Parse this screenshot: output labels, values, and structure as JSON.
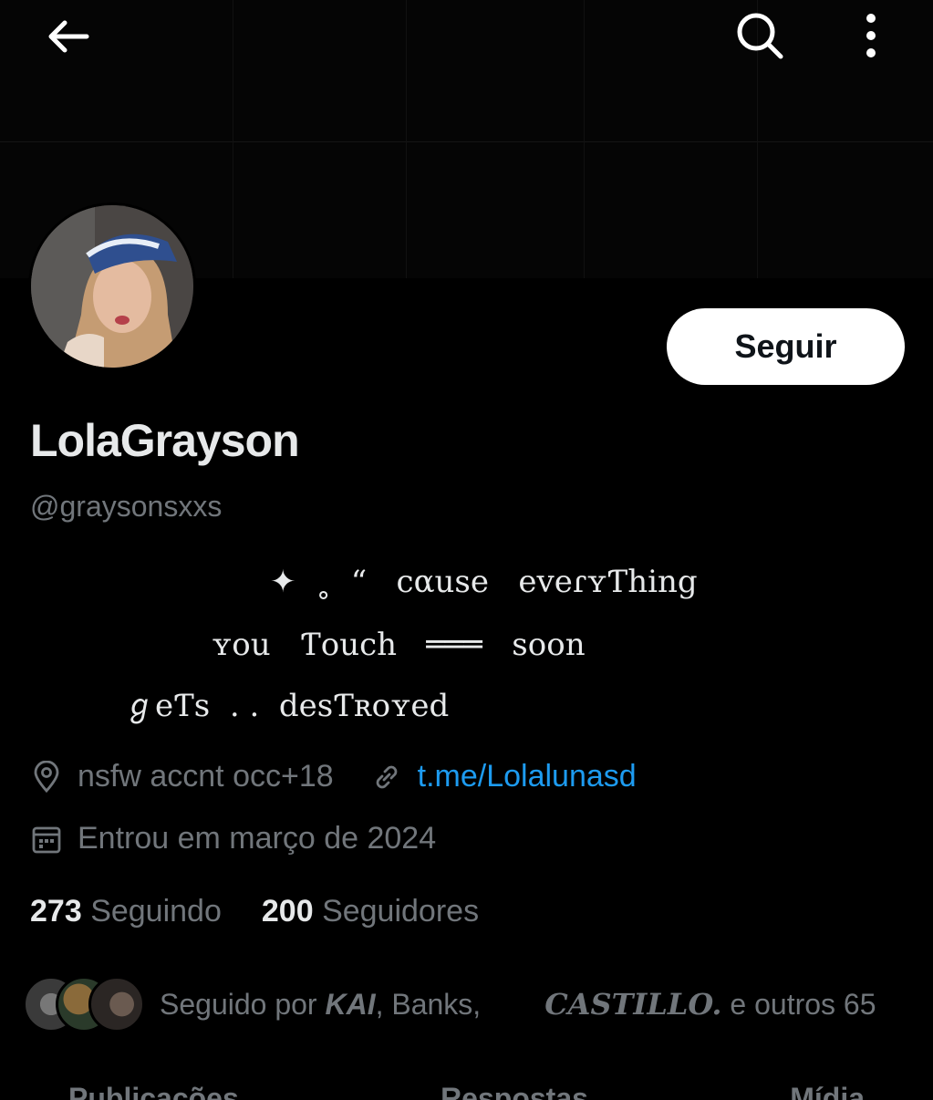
{
  "header": {
    "back_icon": "arrow-left-icon",
    "search_icon": "search-icon",
    "more_icon": "more-vertical-icon"
  },
  "profile": {
    "display_name": "LolaGrayson",
    "handle": "@graysonsxxs",
    "follow_label": "Seguir",
    "bio": {
      "line1": "✦  ˳  “   cαuse   eveɾʏƬhing",
      "line2": "ʏou   Ƭouch   ═══   soon",
      "line3": "ℊeƬs  . .  desƬʀoʏed"
    },
    "location": "nsfw accnt occ+18",
    "link": "t.me/Lolalunasd",
    "joined": "Entrou em março de 2024"
  },
  "stats": {
    "following_count": "273",
    "following_label": "Seguindo",
    "followers_count": "200",
    "followers_label": "Seguidores"
  },
  "followed_by": {
    "prefix": "Seguido por",
    "name1": "KAI",
    "sep1": ",",
    "name2": "Banks,",
    "name3": "CASTILLO.",
    "suffix": "e outros 65"
  },
  "tabs": [
    {
      "label": "Publicações"
    },
    {
      "label": "Respostas"
    },
    {
      "label": "Mídia"
    }
  ],
  "colors": {
    "background": "#000000",
    "text": "#e7e9ea",
    "secondary": "#71767b",
    "link": "#1d9bf0",
    "button": "#ffffff"
  }
}
